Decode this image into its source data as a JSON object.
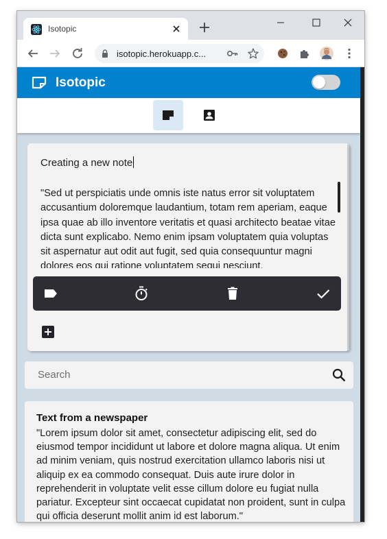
{
  "browser": {
    "tab_title": "Isotopic",
    "url": "isotopic.herokuapp.c..."
  },
  "app": {
    "title": "Isotopic",
    "accent_color": "#0281cf",
    "nav_tabs": [
      {
        "icon": "note-icon",
        "active": true
      },
      {
        "icon": "contact-icon",
        "active": false
      }
    ]
  },
  "editor": {
    "title_value": "Creating a new note",
    "body_value": "\"Sed ut perspiciatis unde omnis iste natus error sit voluptatem accusantium doloremque laudantium, totam rem aperiam, eaque ipsa quae ab illo inventore veritatis et quasi architecto beatae vitae dicta sunt explicabo. Nemo enim ipsam voluptatem quia voluptas sit aspernatur aut odit aut fugit, sed quia consequuntur magni dolores eos qui ratione voluptatem sequi nesciunt.",
    "actions": [
      "tag-icon",
      "timer-icon",
      "delete-icon",
      "check-icon"
    ]
  },
  "search": {
    "placeholder": "Search"
  },
  "notes": [
    {
      "title": "Text from a newspaper",
      "body": "\"Lorem ipsum dolor sit amet, consectetur adipiscing elit, sed do eiusmod tempor incididunt ut labore et dolore magna aliqua. Ut enim ad minim veniam, quis nostrud exercitation ullamco laboris nisi ut aliquip ex ea commodo consequat. Duis aute irure dolor in reprehenderit in voluptate velit esse cillum dolore eu fugiat nulla pariatur. Excepteur sint occaecat cupidatat non proident, sunt in culpa qui officia deserunt mollit anim id est laborum.\""
    }
  ]
}
